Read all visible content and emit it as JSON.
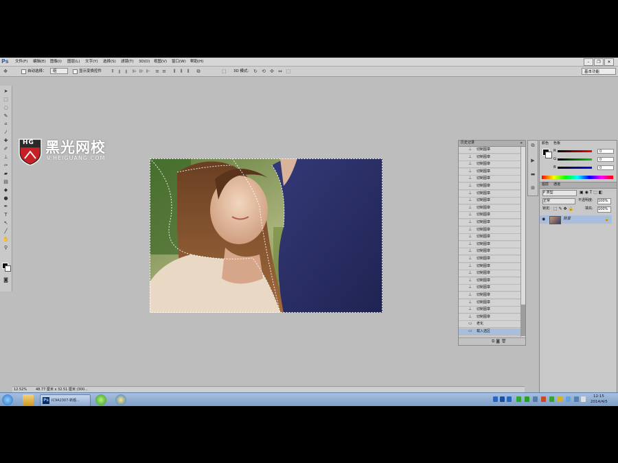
{
  "app": {
    "logo": "Ps"
  },
  "menu": [
    "文件(F)",
    "编辑(E)",
    "图像(I)",
    "图层(L)",
    "文字(Y)",
    "选择(S)",
    "滤镜(T)",
    "3D(D)",
    "视图(V)",
    "窗口(W)",
    "帮助(H)"
  ],
  "window_controls": [
    "–",
    "❐",
    "✕"
  ],
  "options_bar": {
    "auto_select_label": "自动选择：",
    "auto_select_value": "组",
    "show_transform_label": "显示变换控件",
    "mode_3d_label": "3D 模式:",
    "workspace": "基本功能"
  },
  "watermark": {
    "brand": "黑光网校",
    "url": "V.HEIGUANG.COM",
    "badge": "HG"
  },
  "history_panel": {
    "tab": "历史记录",
    "items": [
      "切制图章",
      "切制图章",
      "切制图章",
      "切制图章",
      "切制图章",
      "切制图章",
      "切制图章",
      "切制图章",
      "切制图章",
      "切制图章",
      "切制图章",
      "切制图章",
      "切制图章",
      "切制图章",
      "切制图章",
      "切制图章",
      "切制图章",
      "切制图章",
      "切制图章",
      "切制图章",
      "切制图章",
      "切制图章",
      "切制图章",
      "切制图章",
      "老化",
      "载入选区"
    ],
    "selected_index": 25
  },
  "color_panel": {
    "tabs": [
      "颜色",
      "色板"
    ],
    "channels": [
      {
        "label": "R",
        "value": "0",
        "color": "#e02020"
      },
      {
        "label": "G",
        "value": "0",
        "color": "#20b020"
      },
      {
        "label": "B",
        "value": "0",
        "color": "#2040e0"
      }
    ]
  },
  "layers_panel": {
    "tabs": [
      "图层",
      "通道"
    ],
    "kind_label": "P 类型",
    "blend_mode": "正常",
    "opacity_label": "不透明度:",
    "opacity_value": "100%",
    "lock_label": "锁定:",
    "fill_label": "填充:",
    "fill_value": "100%",
    "layer_name": "背景"
  },
  "status_bar": {
    "zoom": "12.52%",
    "doc_info": "48.77 厘米 x 32.51 厘米 (300..."
  },
  "taskbar": {
    "ps_task_icon": "Ps",
    "ps_task_label": "IC9A2307-新婚...",
    "time": "12:15",
    "date": "2014/4/5"
  }
}
